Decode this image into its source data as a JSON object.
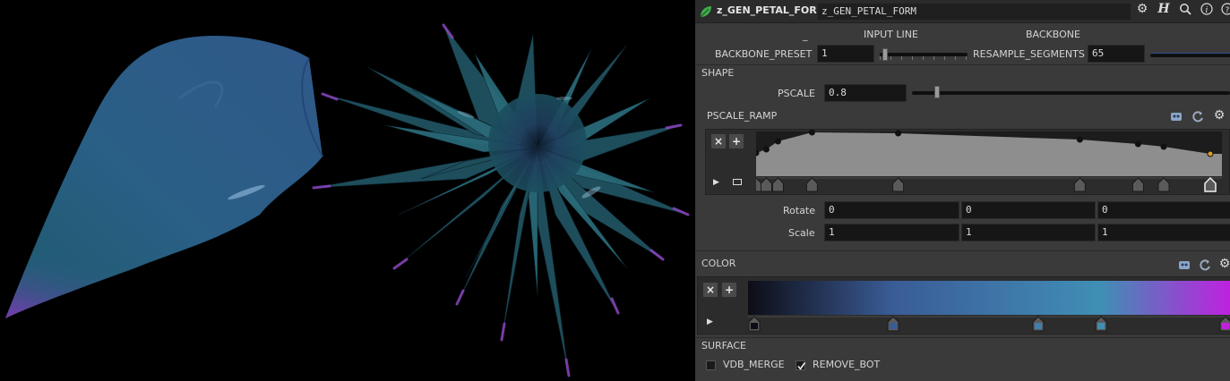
{
  "header": {
    "node_type": "z_GEN_PETAL_FORM",
    "node_name": "z_GEN_PETAL_FORM"
  },
  "params": {
    "dash_label": "_",
    "input_line_label": "INPUT LINE",
    "backbone_label": "BACKBONE",
    "backbone_preset_label": "BACKBONE_PRESET",
    "backbone_preset_value": "1",
    "backbone_preset_fraction": 0.06,
    "resample_segments_label": "RESAMPLE_SEGMENTS",
    "resample_segments_value": "65"
  },
  "shape": {
    "section_label": "SHAPE",
    "pscale_label": "PSCALE",
    "pscale_value": "0.8",
    "pscale_fraction": 0.08,
    "ramp_label": "PSCALE_RAMP",
    "ramp_points": [
      {
        "pos": 0.0,
        "val": 0.52
      },
      {
        "pos": 0.022,
        "val": 0.6
      },
      {
        "pos": 0.047,
        "val": 0.78
      },
      {
        "pos": 0.12,
        "val": 0.98
      },
      {
        "pos": 0.305,
        "val": 0.96
      },
      {
        "pos": 0.695,
        "val": 0.82
      },
      {
        "pos": 0.82,
        "val": 0.72
      },
      {
        "pos": 0.875,
        "val": 0.66
      },
      {
        "pos": 0.975,
        "val": 0.5
      }
    ],
    "ramp_selected_index": 8,
    "rotate_label": "Rotate",
    "rotate_values": [
      "0",
      "0",
      "0"
    ],
    "scale_label": "Scale",
    "scale_values": [
      "1",
      "1",
      "1"
    ]
  },
  "color": {
    "section_label": "COLOR",
    "stops": [
      {
        "pos": 0.0,
        "color": "#0d0d16"
      },
      {
        "pos": 0.3,
        "color": "#3a5c96"
      },
      {
        "pos": 0.6,
        "color": "#3f7fae"
      },
      {
        "pos": 0.73,
        "color": "#3f8fb4"
      },
      {
        "pos": 1.0,
        "color": "#c020e0"
      }
    ]
  },
  "surface": {
    "section_label": "SURFACE",
    "vdb_merge_label": "VDB_MERGE",
    "vdb_merge_checked": false,
    "remove_bot_label": "REMOVE_BOT",
    "remove_bot_checked": true
  },
  "colors": {
    "panel_bg": "#3a3a3a",
    "field_bg": "#161616",
    "ramp_fill": "#8e8e8e",
    "selected_key": "#e0a020",
    "petal_blue": "#27507a",
    "petal_purple": "#7a3aa8"
  },
  "icons": [
    "leaf-icon",
    "gear-icon",
    "help-script-icon",
    "search-icon",
    "info-icon",
    "help-icon",
    "preset-icon",
    "reset-icon",
    "remove-key-icon",
    "add-key-icon",
    "play-icon",
    "frame-icon"
  ]
}
